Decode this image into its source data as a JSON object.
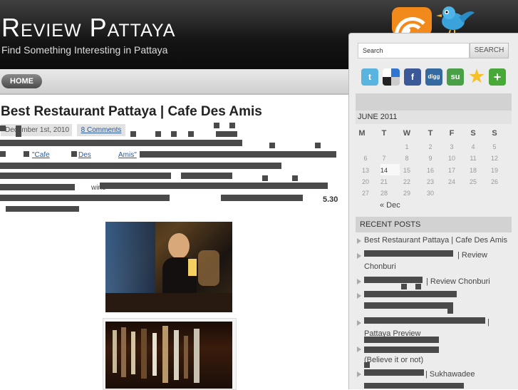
{
  "header": {
    "site_title": "Review Pattaya",
    "tagline": "Find Something Interesting in Pattaya"
  },
  "nav": {
    "home": "HOME"
  },
  "post": {
    "title": "Best Restaurant Pattaya | Cafe Des Amis",
    "date": "December 1st, 2010",
    "comments": "8 Comments",
    "link_words": [
      "\"Cafe",
      "Des",
      "Amis\""
    ],
    "fragment_wine": "wine",
    "price": "5.30"
  },
  "sidebar": {
    "search_placeholder": "Search",
    "search_button": "SEARCH",
    "social_icons": [
      "twitter-icon",
      "delicious-icon",
      "facebook-icon",
      "digg-icon",
      "stumbleupon-icon",
      "favorite-star-icon",
      "add-plus-icon"
    ],
    "calendar": {
      "month": "JUNE 2011",
      "weekdays": [
        "M",
        "T",
        "W",
        "T",
        "F",
        "S",
        "S"
      ],
      "weeks": [
        [
          "",
          "",
          "1",
          "2",
          "3",
          "4",
          "5"
        ],
        [
          "6",
          "7",
          "8",
          "9",
          "10",
          "11",
          "12"
        ],
        [
          "13",
          "14",
          "15",
          "16",
          "17",
          "18",
          "19"
        ],
        [
          "20",
          "21",
          "22",
          "23",
          "24",
          "25",
          "26"
        ],
        [
          "27",
          "28",
          "29",
          "30",
          "",
          "",
          ""
        ]
      ],
      "today": "14",
      "prev_link": "« Dec"
    },
    "recent_posts": {
      "heading": "RECENT POSTS",
      "items": [
        "Best Restaurant Pattaya | Cafe Des Amis",
        "| Review",
        "Chonburi",
        "| Review Chonburi",
        "|",
        "Pattaya Preview",
        "(Believe it or not)",
        "| Sukhawadee"
      ]
    }
  },
  "colors": {
    "header_bg": "#141414",
    "rss": "#f28a1b",
    "twitter_bird": "#3aa3dc",
    "link": "#2a5a9a"
  }
}
